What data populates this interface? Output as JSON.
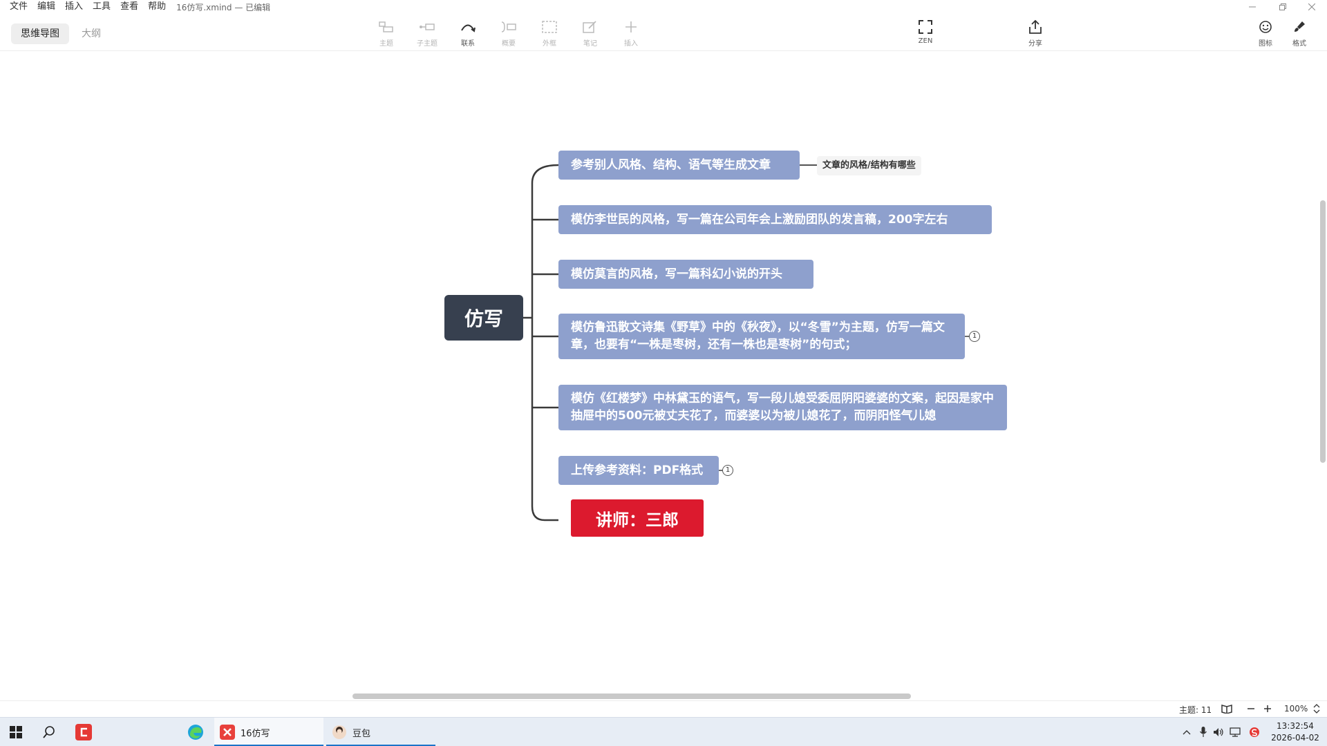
{
  "menu": {
    "items": [
      "文件",
      "编辑",
      "插入",
      "工具",
      "查看",
      "帮助"
    ],
    "doc_title": "16仿写.xmind — 已编辑"
  },
  "toolbar": {
    "view_tabs": [
      "思维导图",
      "大纲"
    ],
    "tools": {
      "topic": "主题",
      "subtopic": "子主题",
      "relationship": "联系",
      "summary": "概要",
      "boundary": "外框",
      "note": "笔记",
      "insert": "插入",
      "zen": "ZEN",
      "share": "分享",
      "icon": "图标",
      "format": "格式"
    }
  },
  "mindmap": {
    "central": "仿写",
    "topics": [
      "参考别人风格、结构、语气等生成文章",
      "模仿李世民的风格，写一篇在公司年会上激励团队的发言稿，200字左右",
      "模仿莫言的风格，写一篇科幻小说的开头",
      "模仿鲁迅散文诗集《野草》中的《秋夜》，以“冬雪”为主题，仿写一篇文章，也要有“一株是枣树，还有一株也是枣树”的句式；",
      "模仿《红楼梦》中林黛玉的语气，写一段儿媳受委屈阴阳婆婆的文案，起因是家中抽屉中的500元被丈夫花了，而婆婆以为被儿媳花了，而阴阳怪气儿媳",
      "上传参考资料：PDF格式"
    ],
    "sub_note": "文章的风格/结构有哪些",
    "badge_1": "1",
    "badge_2": "1",
    "lecturer": "讲师：三郎"
  },
  "status": {
    "topic_count": "主题: 11",
    "zoom": "100%"
  },
  "taskbar": {
    "apps": [
      "16仿写",
      "豆包"
    ],
    "time": "13:32:54",
    "date": "2026-04-02"
  },
  "colors": {
    "topic_fill": "#8ea0cd",
    "central_fill": "#37404f",
    "lecturer_fill": "#dc1a2e",
    "connector": "#3a3a3a"
  }
}
